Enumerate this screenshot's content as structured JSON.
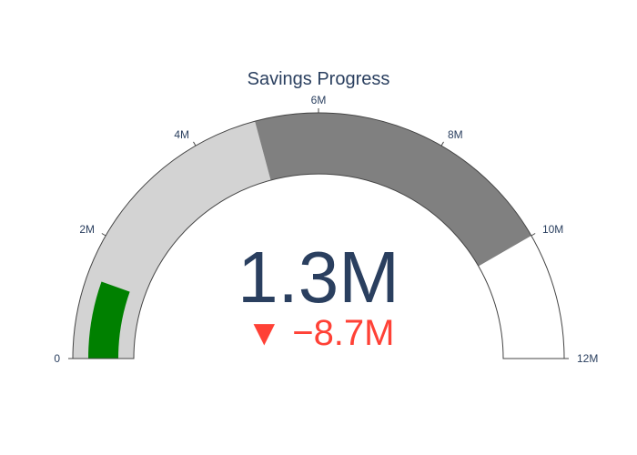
{
  "chart_data": {
    "type": "gauge",
    "title": "Savings Progress",
    "value": 1300000,
    "value_label": "1.3M",
    "reference": 10000000,
    "delta": -8700000,
    "delta_label": "−8.7M",
    "delta_symbol": "▼",
    "range": [
      0,
      12000000
    ],
    "ticks": [
      {
        "value": 0,
        "label": "0"
      },
      {
        "value": 2000000,
        "label": "2M"
      },
      {
        "value": 4000000,
        "label": "4M"
      },
      {
        "value": 6000000,
        "label": "6M"
      },
      {
        "value": 8000000,
        "label": "8M"
      },
      {
        "value": 10000000,
        "label": "10M"
      },
      {
        "value": 12000000,
        "label": "12M"
      }
    ],
    "steps": [
      {
        "range": [
          0,
          5000000
        ],
        "color": "#d3d3d3"
      },
      {
        "range": [
          5000000,
          10000000
        ],
        "color": "#808080"
      }
    ],
    "bar_color": "#008000",
    "delta_color": "#ff4136",
    "value_color": "#2a3f5f",
    "grid": false,
    "legend": "none"
  }
}
